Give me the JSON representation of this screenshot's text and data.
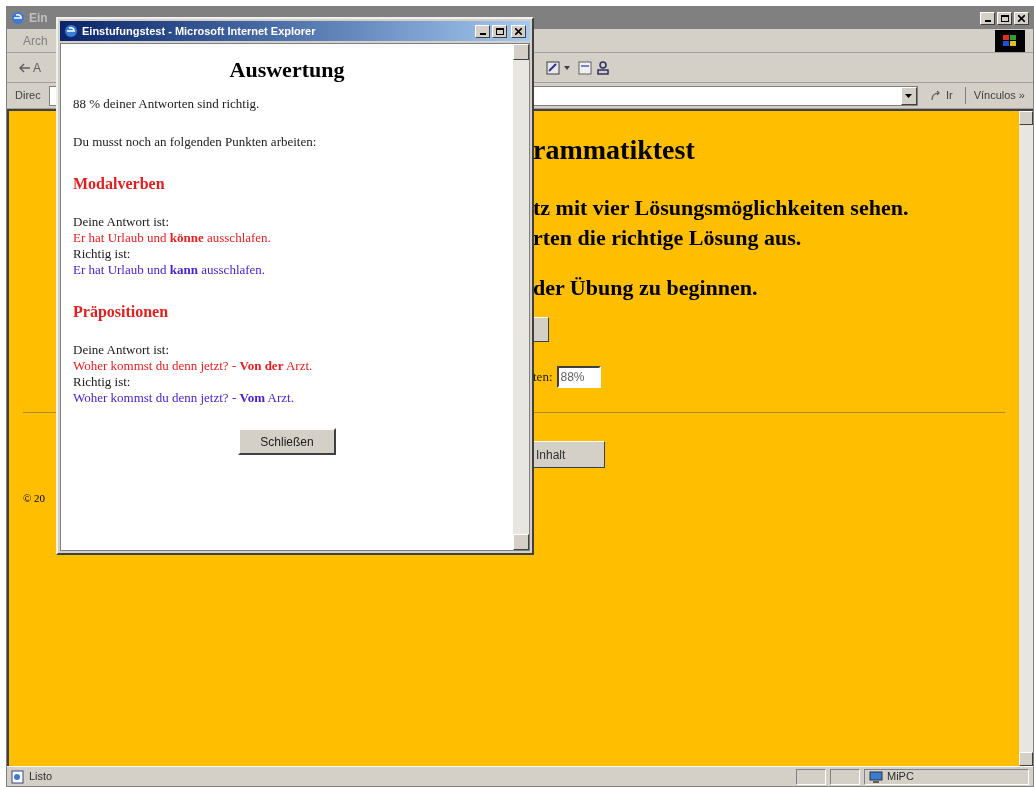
{
  "browser": {
    "title": "Ein",
    "menu_bar": [
      "Arch"
    ],
    "back_button": "A",
    "address_label": "Direc",
    "go_button": "Ir",
    "links_button": "Vínculos »"
  },
  "page": {
    "heading": "rammatiktest",
    "lines": [
      "tz mit vier Lösungsmöglichkeiten sehen.",
      "rten die richtige Lösung aus."
    ],
    "start_line": "der Übung zu beginnen.",
    "result_label": "ten:",
    "result_value": "88%",
    "content_button": "Inhalt",
    "footer": "© 20"
  },
  "status_bar": {
    "text": "Listo",
    "zone": "MiPC"
  },
  "popup": {
    "title": "Einstufungstest - Microsoft Internet Explorer",
    "heading": "Auswertung",
    "score_text": "88 % deiner Antworten sind richtig.",
    "intro": "Du musst noch an folgenden Punkten arbeiten:",
    "topics": [
      {
        "name": "Modalverben",
        "answer_label": "Deine Antwort ist:",
        "answer": "Er hat Urlaub und **könne** ausschlafen.",
        "correct_label": "Richtig ist:",
        "correct": "Er hat Urlaub und **kann** ausschlafen."
      },
      {
        "name": "Präpositionen",
        "answer_label": "Deine Antwort ist:",
        "answer": "Woher kommst du denn jetzt? - **Von der** Arzt.",
        "correct_label": "Richtig ist:",
        "correct": "Woher kommst du denn jetzt? - **Vom** Arzt."
      }
    ],
    "close_button": "Schließen"
  }
}
